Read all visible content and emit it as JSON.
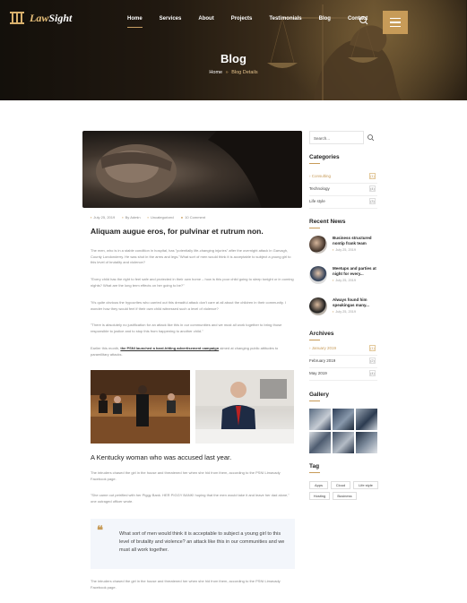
{
  "brand": {
    "name_part1": "Law",
    "name_part2": "Sight",
    "accent": "#c79b58"
  },
  "nav": {
    "items": [
      "Home",
      "Services",
      "About",
      "Projects",
      "Testimonials",
      "Blog",
      "Contact"
    ],
    "active_index": 0
  },
  "hero": {
    "title": "Blog",
    "breadcrumb": {
      "home": "Home",
      "sep": "»",
      "current": "Blog Details"
    }
  },
  "post": {
    "meta": {
      "date": "July 25, 2019",
      "author": "By Admin",
      "category": "Uncategorized",
      "comments": "10 Comment"
    },
    "title": "Aliquam augue eros, for pulvinar et rutrum non.",
    "paragraphs": [
      "The men, who is in a stable condition in hospital, has \"potentially life-changing injuries\" after the overnight attack in Garvagh, County Londonderry. He was shot in the arms and legs.\"What sort of men would think it is acceptable to subject a young girl to this level of brutality and violence?",
      "\"Every child has the right to feel safe and protected in their own home – how is this poor child going to sleep tonight or in coming nights? What are the long term effects on her going to be?\"",
      "\"It's quite obvious the hypocrites who carried out this dreadful attack don't care at all about the children in their community. I wonder how they would feel if their own child witnessed such a level of violence?",
      "\"There is absolutely no justification for an attack like this in our communities and we must all work together to bring those responsible to justice and to stop this from happening to another child.\""
    ],
    "link_para_before": "Earlier this month, ",
    "link_text": "the PSNI launched a hard-hitting advertisement campaign",
    "link_para_after": " aimed at changing public attitudes to paramilitary attacks.",
    "subtitle": "A Kentucky woman who was accused last year.",
    "sub_paragraphs": [
      "The intruders chased the girl in the house and threatened her when she hid from them, according to the PSNI Limavady Facebook page.",
      "\"She came out petrified with her Piggy Bank. HER PIGGY BANK! hoping that the men would take it and leave her dad alone,\" one outraged officer wrote."
    ],
    "quote": "What sort of men would think it is acceptable to subject a young girl to this level of brutality and violence? an attack like this in our communities and we must all work together.",
    "after_quote": "The intruders chased the girl in the house and threatened her when she hid from them, according to the PSNI Limavady Facebook page."
  },
  "sidebar": {
    "search_placeholder": "Search...",
    "categories_title": "Categories",
    "categories": [
      {
        "label": "Consulting",
        "count": "(1)",
        "active": true
      },
      {
        "label": "Technology",
        "count": "(4)",
        "active": false
      },
      {
        "label": "Life style",
        "count": "(3)",
        "active": false
      }
    ],
    "recent_title": "Recent News",
    "recent": [
      {
        "title": "Business structured nontip frank team",
        "date": "July 25, 2019"
      },
      {
        "title": "Meetups and parties at night for every...",
        "date": "July 25, 2019"
      },
      {
        "title": "Always found him speakingas many...",
        "date": "July 25, 2019"
      }
    ],
    "archives_title": "Archives",
    "archives": [
      {
        "label": "January 2019",
        "count": "(1)",
        "active": true
      },
      {
        "label": "February 2019",
        "count": "(2)",
        "active": false
      },
      {
        "label": "May 2019",
        "count": "(4)",
        "active": false
      }
    ],
    "gallery_title": "Gallery",
    "tag_title": "Tag",
    "tags": [
      "Apps",
      "Cloud",
      "Life style",
      "Hosting",
      "Business"
    ]
  }
}
